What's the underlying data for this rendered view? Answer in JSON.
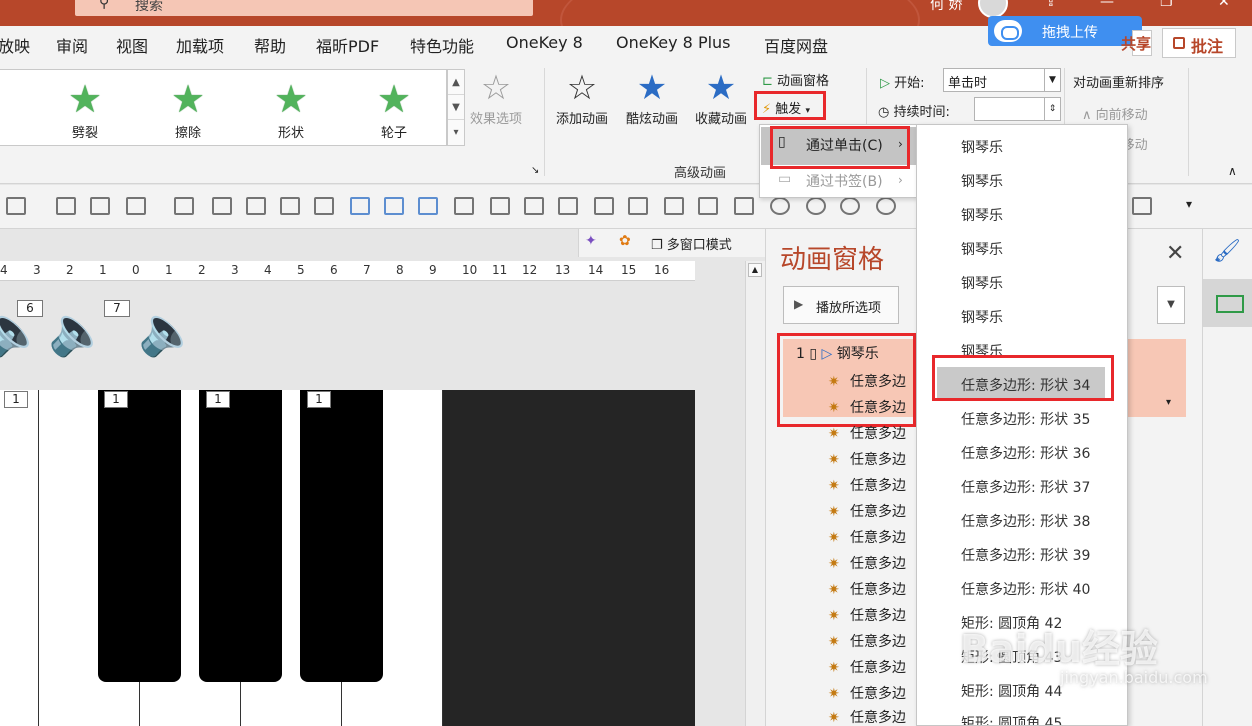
{
  "titlebar": {
    "search_text": "搜索",
    "user_name": "何 娇",
    "colors": {
      "accent": "#b7472a",
      "highlight": "#e8282b",
      "selection": "#f7c7b5"
    }
  },
  "menubar": {
    "items": [
      "放映",
      "审阅",
      "视图",
      "加载项",
      "帮助",
      "福昕PDF",
      "特色功能",
      "OneKey 8",
      "OneKey 8 Plus",
      "百度网盘"
    ],
    "upload_label": "拖拽上传",
    "share_label": "共享",
    "comment_label": "批注"
  },
  "ribbon": {
    "effects": [
      "劈裂",
      "擦除",
      "形状",
      "轮子"
    ],
    "effect_options": "效果选项",
    "add_animation": "添加动画",
    "cool_animation": "酷炫动画",
    "favorite_animation": "收藏动画",
    "animation_pane": "动画窗格",
    "trigger": "触发",
    "group_label": "高级动画",
    "start_label": "开始:",
    "start_value": "单击时",
    "duration_label": "持续时间:",
    "reorder_label": "对动画重新排序",
    "move_earlier": "向前移动",
    "move_later": "向后移动"
  },
  "workspace": {
    "multi_window": "多窗口模式",
    "ruler_ticks": [
      "4",
      "3",
      "2",
      "1",
      "0",
      "1",
      "2",
      "3",
      "4",
      "5",
      "6",
      "7",
      "8",
      "9",
      "10",
      "11",
      "12",
      "13",
      "14",
      "15",
      "16"
    ],
    "speaker_badges": [
      "6",
      "7"
    ],
    "key_badges": [
      "1",
      "1",
      "1",
      "1"
    ]
  },
  "pane": {
    "title": "动画窗格",
    "play_selected": "播放所选项",
    "first_item": {
      "number": "1",
      "name": "钢琴乐"
    },
    "items": [
      "任意多边",
      "任意多边",
      "任意多边",
      "任意多边",
      "任意多边",
      "任意多边",
      "任意多边",
      "任意多边",
      "任意多边",
      "任意多边",
      "任意多边",
      "任意多边",
      "任意多边",
      "任意多边"
    ]
  },
  "trigger_menu": {
    "on_click": "通过单击(C)",
    "on_bookmark": "通过书签(B)"
  },
  "shape_menu": {
    "items": [
      "钢琴乐",
      "钢琴乐",
      "钢琴乐",
      "钢琴乐",
      "钢琴乐",
      "钢琴乐",
      "钢琴乐",
      "任意多边形: 形状 34",
      "任意多边形: 形状 35",
      "任意多边形: 形状 36",
      "任意多边形: 形状 37",
      "任意多边形: 形状 38",
      "任意多边形: 形状 39",
      "任意多边形: 形状 40",
      "矩形: 圆顶角 42",
      "矩形: 圆顶角 43",
      "矩形: 圆顶角 44",
      "矩形: 圆顶角 45"
    ],
    "hovered_index": 7
  },
  "watermark": {
    "brand": "Baidu经验",
    "url": "jingyan.baidu.com"
  }
}
